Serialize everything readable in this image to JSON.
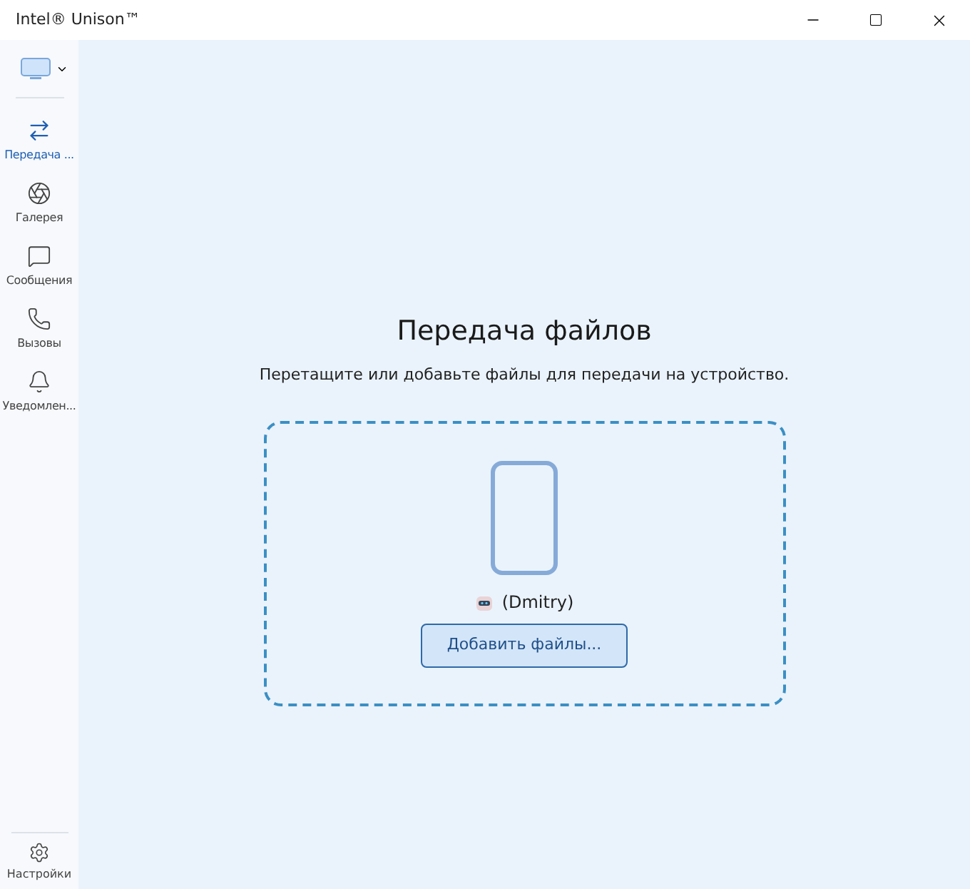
{
  "window": {
    "title": "Intel® Unison™"
  },
  "sidebar": {
    "items": [
      {
        "kind": "transfer",
        "label": "Передача ...",
        "selected": true
      },
      {
        "kind": "gallery",
        "label": "Галерея",
        "selected": false
      },
      {
        "kind": "messages",
        "label": "Сообщения",
        "selected": false
      },
      {
        "kind": "calls",
        "label": "Вызовы",
        "selected": false
      },
      {
        "kind": "notifications",
        "label": "Уведомлен...",
        "selected": false
      }
    ],
    "settings": {
      "label": "Настройки"
    }
  },
  "main": {
    "title": "Передача файлов",
    "subtitle": "Перетащите или добавьте файлы для передачи на устройство.",
    "device_name": "(Dmitry)",
    "button": "Добавить файлы..."
  }
}
